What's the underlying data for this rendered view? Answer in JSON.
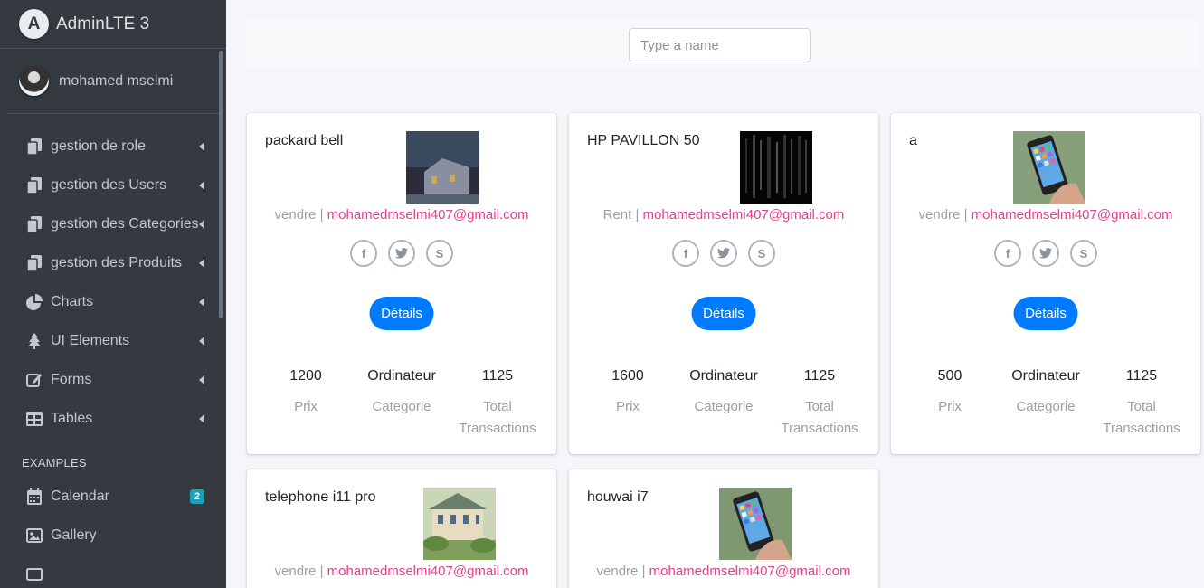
{
  "brand": {
    "logo_letter": "A",
    "name": "AdminLTE 3"
  },
  "user": {
    "name": "mohamed mselmi"
  },
  "sidebar": {
    "items": [
      {
        "label": "gestion de role",
        "icon": "copy-icon"
      },
      {
        "label": "gestion des Users",
        "icon": "copy-icon"
      },
      {
        "label": "gestion des Categories",
        "icon": "copy-icon"
      },
      {
        "label": "gestion des Produits",
        "icon": "copy-icon"
      },
      {
        "label": "Charts",
        "icon": "pie-chart-icon"
      },
      {
        "label": "UI Elements",
        "icon": "tree-icon"
      },
      {
        "label": "Forms",
        "icon": "edit-icon"
      },
      {
        "label": "Tables",
        "icon": "table-icon"
      }
    ],
    "header": "EXAMPLES",
    "examples": [
      {
        "label": "Calendar",
        "icon": "calendar-icon",
        "badge": "2"
      },
      {
        "label": "Gallery",
        "icon": "image-icon"
      }
    ]
  },
  "search": {
    "placeholder": "Type a name"
  },
  "labels": {
    "details": "Détails",
    "prix": "Prix",
    "categorie": "Categorie",
    "total": "Total",
    "transactions": "Transactions",
    "separator": " | "
  },
  "products": [
    {
      "name": "packard bell",
      "mode": "vendre",
      "email": "mohamedmselmi407@gmail.com",
      "price": "1200",
      "category": "Ordinateur",
      "transactions": "1125"
    },
    {
      "name": "HP PAVILLON 50",
      "mode": "Rent",
      "email": "mohamedmselmi407@gmail.com",
      "price": "1600",
      "category": "Ordinateur",
      "transactions": "1125"
    },
    {
      "name": "a",
      "mode": "vendre",
      "email": "mohamedmselmi407@gmail.com",
      "price": "500",
      "category": "Ordinateur",
      "transactions": "1125"
    },
    {
      "name": "telephone i11 pro",
      "mode": "vendre",
      "email": "mohamedmselmi407@gmail.com"
    },
    {
      "name": "houwai i7",
      "mode": "vendre",
      "email": "mohamedmselmi407@gmail.com"
    }
  ],
  "colors": {
    "sidebar_bg": "#343a40",
    "accent": "#007bff",
    "email": "#e83e8c",
    "badge": "#17a2b8"
  }
}
